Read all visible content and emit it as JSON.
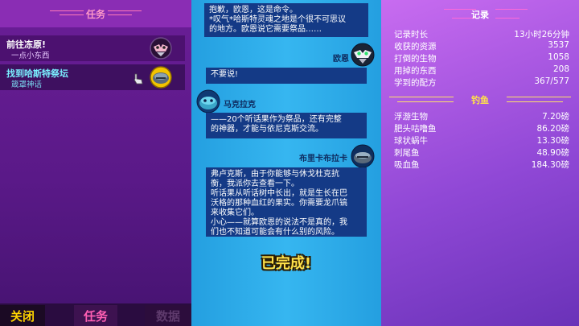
{
  "quests": {
    "header": "任务",
    "items": [
      {
        "title": "前往冻原!",
        "subtitle": "一点小东西"
      },
      {
        "title": "找到哈斯特祭坛",
        "subtitle": "箴罩神话"
      }
    ]
  },
  "bottom_tabs": {
    "close": "关闭",
    "tasks": "任务",
    "data": "数据"
  },
  "dialogue": [
    {
      "speaker": "",
      "text": "抱歉，欧恩，这是命令。\n*叹气*哈斯特灵魂之地是个很不可思议\n的地方。欧恩说它需要祭品……"
    },
    {
      "speaker": "欧恩",
      "text": "不要说!"
    },
    {
      "speaker": "马克拉克",
      "text": "——20个听话果作为祭品，还有完整\n的神器，才能与依尼克斯交流。"
    },
    {
      "speaker": "布里卡布拉卡",
      "text": "弗卢克斯，由于你能够与休戈杜克抗\n衡，我派你去查看一下。\n听话果从听话树中长出，就是生长在巴\n沃格的那种血红的果实。你需要龙爪镐\n来收集它们。\n小心——就算欧恩的说法不是真的，我\n们也不知道可能会有什么别的风险。"
    }
  ],
  "completed_label": "已完成!",
  "records": {
    "title": "记录",
    "rows": [
      {
        "label": "记录时长",
        "value": "13小时26分钟"
      },
      {
        "label": "收获的资源",
        "value": "3537"
      },
      {
        "label": "打倒的生物",
        "value": "1058"
      },
      {
        "label": "用掉的东西",
        "value": "208"
      },
      {
        "label": "学到的配方",
        "value": "367/577"
      }
    ]
  },
  "fishing": {
    "title": "钓鱼",
    "rows": [
      {
        "label": "浮游生物",
        "value": "7.20磅"
      },
      {
        "label": "肥头咕噜鱼",
        "value": "86.20磅"
      },
      {
        "label": "球状蜗牛",
        "value": "13.30磅"
      },
      {
        "label": "刺尾鱼",
        "value": "48.90磅"
      },
      {
        "label": "吸血鱼",
        "value": "184.30磅"
      }
    ]
  },
  "colors": {
    "accent_pink": "#ff5fb4",
    "accent_yellow": "#ffd400",
    "bubble": "#143a86",
    "cyan": "#7af0ff"
  }
}
